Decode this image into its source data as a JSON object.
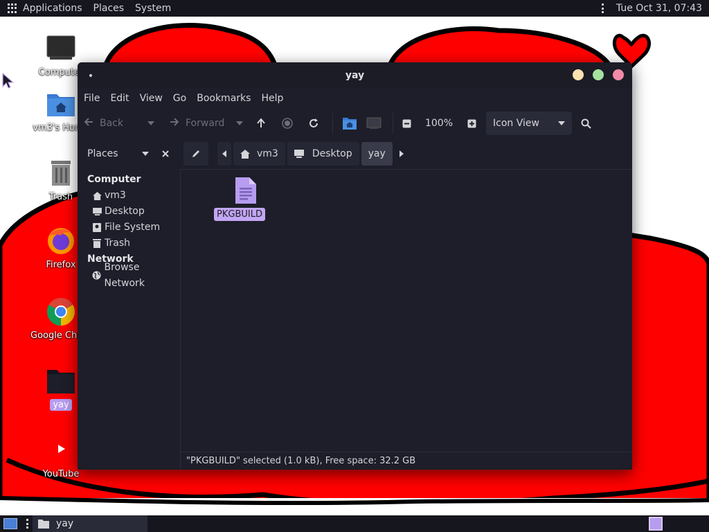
{
  "top_panel": {
    "menus": [
      "Applications",
      "Places",
      "System"
    ],
    "clock": "Tue Oct 31, 07:43"
  },
  "desktop": {
    "icons": [
      {
        "label": "Computer",
        "icon": "monitor-icon"
      },
      {
        "label": "vm3's Home",
        "icon": "home-folder-icon"
      },
      {
        "label": "Trash",
        "icon": "trash-icon"
      },
      {
        "label": "Firefox",
        "icon": "firefox-icon"
      },
      {
        "label": "Google Chrome",
        "icon": "chrome-icon"
      },
      {
        "label": "yay",
        "icon": "folder-icon"
      },
      {
        "label": "YouTube",
        "icon": "youtube-icon"
      }
    ]
  },
  "window": {
    "title": "yay",
    "menus": [
      "File",
      "Edit",
      "View",
      "Go",
      "Bookmarks",
      "Help"
    ],
    "toolbar": {
      "back_label": "Back",
      "forward_label": "Forward",
      "zoom": "100%",
      "view_mode": "Icon View"
    },
    "places_label": "Places",
    "pathbar": [
      "vm3",
      "Desktop",
      "yay"
    ],
    "sidebar": {
      "sections": [
        {
          "heading": "Computer",
          "items": [
            {
              "label": "vm3",
              "icon": "home-icon"
            },
            {
              "label": "Desktop",
              "icon": "desktop-icon"
            },
            {
              "label": "File System",
              "icon": "drive-icon"
            },
            {
              "label": "Trash",
              "icon": "trash-icon"
            }
          ]
        },
        {
          "heading": "Network",
          "items": [
            {
              "label": "Browse Network",
              "icon": "network-icon"
            }
          ]
        }
      ]
    },
    "files": [
      {
        "name": "PKGBUILD",
        "icon": "text-file-icon",
        "selected": true
      }
    ],
    "status": "\"PKGBUILD\" selected (1.0 kB), Free space: 32.2 GB"
  },
  "bottom_panel": {
    "task_label": "yay"
  },
  "colors": {
    "accent": "#c3a6f3",
    "window_bg": "#1d1e29",
    "close": "#f38ba8",
    "maximize": "#a6e3a1",
    "minimize": "#f9e2af",
    "wallpaper_red": "#ff0000"
  }
}
